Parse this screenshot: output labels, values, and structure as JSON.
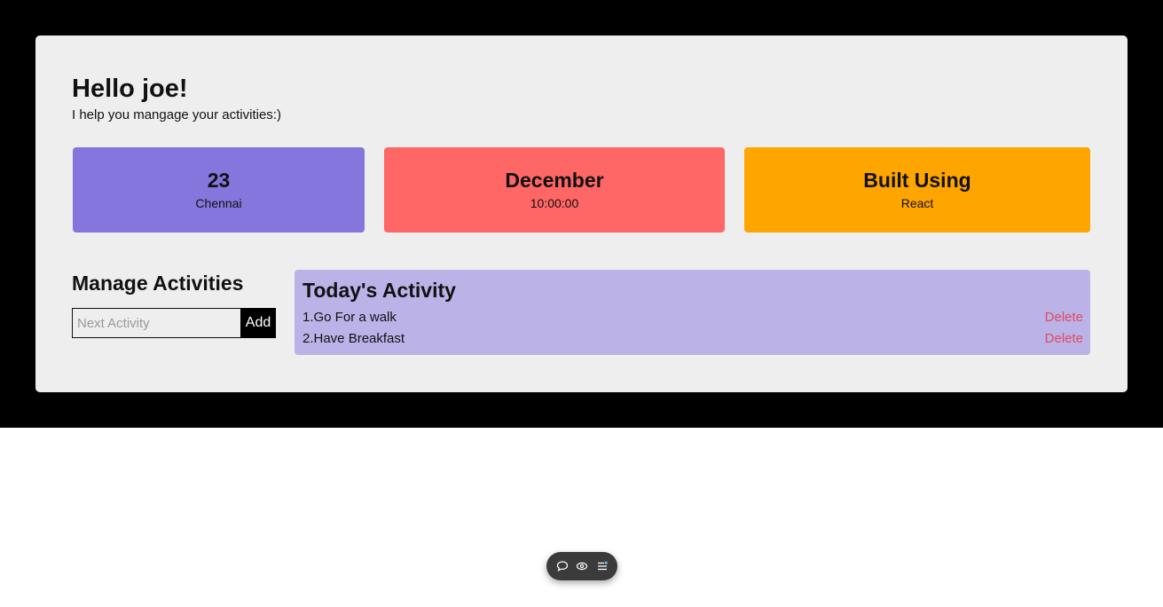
{
  "header": {
    "greeting": "Hello joe!",
    "subtitle": "I help you mangage your activities:)"
  },
  "tiles": [
    {
      "big": "23",
      "small": "Chennai",
      "color": "#8576dd"
    },
    {
      "big": "December",
      "small": "10:00:00",
      "color": "#ff6666"
    },
    {
      "big": "Built Using",
      "small": "React",
      "color": "#ffa500"
    }
  ],
  "manage": {
    "title": "Manage Activities",
    "input_placeholder": "Next Activity",
    "input_value": "",
    "add_label": "Add"
  },
  "activity": {
    "title": "Today's Activity",
    "items": [
      {
        "text": "1.Go For a walk",
        "action": "Delete"
      },
      {
        "text": "2.Have Breakfast",
        "action": "Delete"
      }
    ]
  },
  "toolbar": {
    "icons": [
      "chat-bubble-icon",
      "eye-icon",
      "list-menu-icon"
    ]
  },
  "colors": {
    "page_background": "#000000",
    "card_background": "#eeeeee",
    "activity_background": "#bbb3e8",
    "delete_color": "#e04a5f"
  }
}
